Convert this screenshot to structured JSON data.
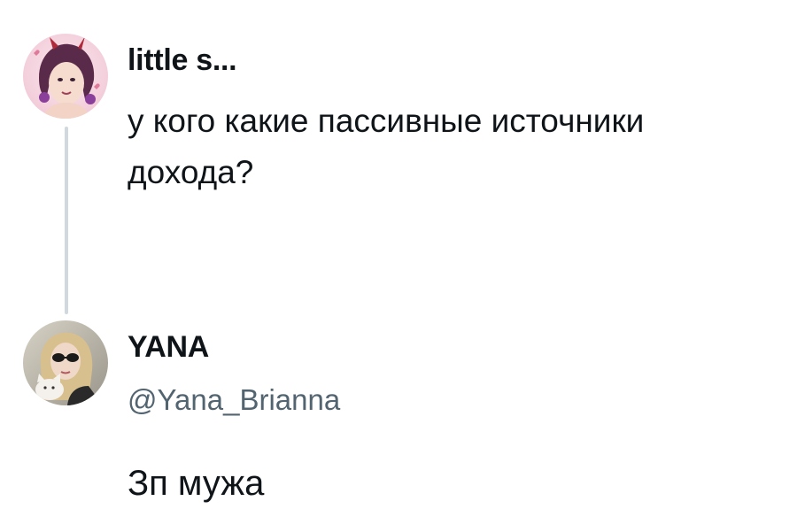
{
  "thread": {
    "original": {
      "display_name": "little s...",
      "text": "у кого какие пассивные источники дохода?"
    },
    "reply": {
      "display_name": "YANA",
      "handle": "@Yana_Brianna",
      "text": "Зп мужа"
    }
  },
  "colors": {
    "text_primary": "#0f1419",
    "text_secondary": "#536471",
    "thread_line": "#cfd9de"
  }
}
